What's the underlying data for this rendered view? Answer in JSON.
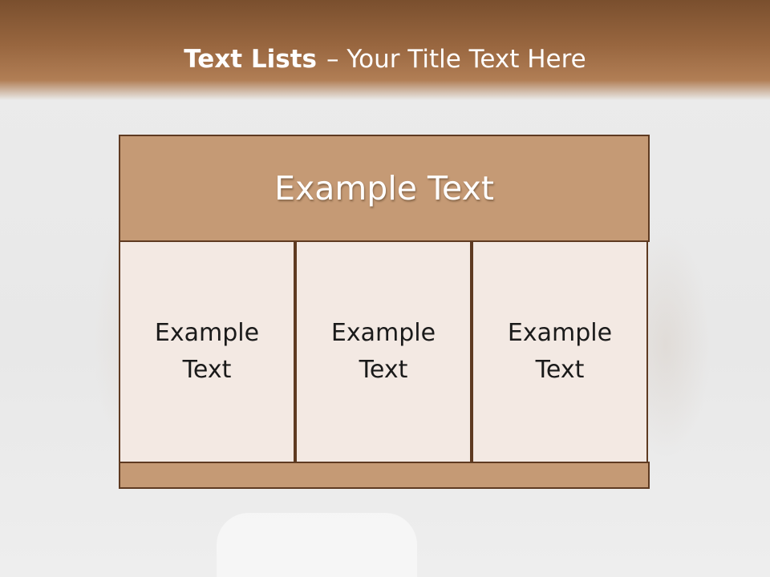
{
  "slide": {
    "title_bold": "Text Lists",
    "title_rest": "– Your Title Text Here"
  },
  "diagram": {
    "header": "Example Text",
    "columns": [
      {
        "line1": "Example",
        "line2": "Text"
      },
      {
        "line1": "Example",
        "line2": "Text"
      },
      {
        "line1": "Example",
        "line2": "Text"
      }
    ]
  },
  "colors": {
    "title_bar": "#98663f",
    "header_fill": "#c59a75",
    "cell_fill": "#f3e9e3",
    "border": "#5e3a21"
  }
}
